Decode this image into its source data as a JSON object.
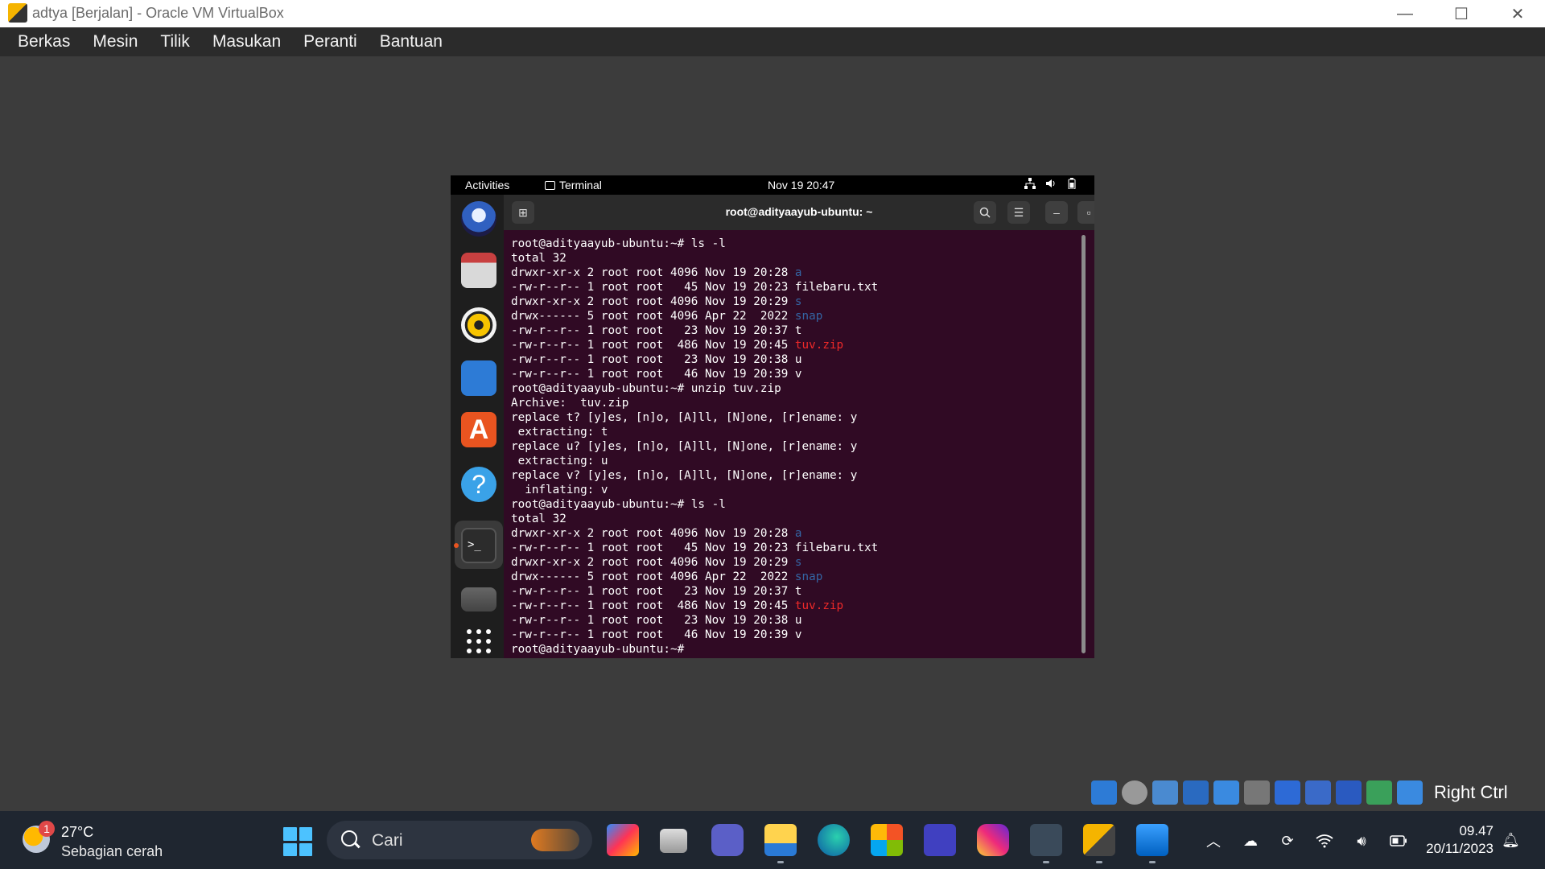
{
  "host_window": {
    "title": "adtya [Berjalan] - Oracle VM VirtualBox",
    "minimize_glyph": "—",
    "maximize_glyph": "☐",
    "close_glyph": "✕"
  },
  "menubar": [
    "Berkas",
    "Mesin",
    "Tilik",
    "Masukan",
    "Peranti",
    "Bantuan"
  ],
  "ubuntu_topbar": {
    "activities": "Activities",
    "app_name": "Terminal",
    "datetime": "Nov 19  20:47"
  },
  "terminal": {
    "title": "root@adityaayub-ubuntu: ~",
    "prompt": "root@adityaayub-ubuntu:~#",
    "lines": [
      {
        "text": "root@adityaayub-ubuntu:~# ls -l"
      },
      {
        "text": "total 32"
      },
      {
        "text": "drwxr-xr-x 2 root root 4096 Nov 19 20:28 ",
        "name": "a",
        "kind": "dir"
      },
      {
        "text": "-rw-r--r-- 1 root root   45 Nov 19 20:23 filebaru.txt"
      },
      {
        "text": "drwxr-xr-x 2 root root 4096 Nov 19 20:29 ",
        "name": "s",
        "kind": "dir"
      },
      {
        "text": "drwx------ 5 root root 4096 Apr 22  2022 ",
        "name": "snap",
        "kind": "dir"
      },
      {
        "text": "-rw-r--r-- 1 root root   23 Nov 19 20:37 t"
      },
      {
        "text": "-rw-r--r-- 1 root root  486 Nov 19 20:45 ",
        "name": "tuv.zip",
        "kind": "zip"
      },
      {
        "text": "-rw-r--r-- 1 root root   23 Nov 19 20:38 u"
      },
      {
        "text": "-rw-r--r-- 1 root root   46 Nov 19 20:39 v"
      },
      {
        "text": "root@adityaayub-ubuntu:~# unzip tuv.zip"
      },
      {
        "text": "Archive:  tuv.zip"
      },
      {
        "text": "replace t? [y]es, [n]o, [A]ll, [N]one, [r]ename: y"
      },
      {
        "text": " extracting: t"
      },
      {
        "text": "replace u? [y]es, [n]o, [A]ll, [N]one, [r]ename: y"
      },
      {
        "text": " extracting: u"
      },
      {
        "text": "replace v? [y]es, [n]o, [A]ll, [N]one, [r]ename: y"
      },
      {
        "text": "  inflating: v"
      },
      {
        "text": "root@adityaayub-ubuntu:~# ls -l"
      },
      {
        "text": "total 32"
      },
      {
        "text": "drwxr-xr-x 2 root root 4096 Nov 19 20:28 ",
        "name": "a",
        "kind": "dir"
      },
      {
        "text": "-rw-r--r-- 1 root root   45 Nov 19 20:23 filebaru.txt"
      },
      {
        "text": "drwxr-xr-x 2 root root 4096 Nov 19 20:29 ",
        "name": "s",
        "kind": "dir"
      },
      {
        "text": "drwx------ 5 root root 4096 Apr 22  2022 ",
        "name": "snap",
        "kind": "dir"
      },
      {
        "text": "-rw-r--r-- 1 root root   23 Nov 19 20:37 t"
      },
      {
        "text": "-rw-r--r-- 1 root root  486 Nov 19 20:45 ",
        "name": "tuv.zip",
        "kind": "zip"
      },
      {
        "text": "-rw-r--r-- 1 root root   23 Nov 19 20:38 u"
      },
      {
        "text": "-rw-r--r-- 1 root root   46 Nov 19 20:39 v"
      },
      {
        "text": "root@adityaayub-ubuntu:~# "
      }
    ]
  },
  "vbox_status": {
    "host_key": "Right Ctrl"
  },
  "taskbar": {
    "weather_temp": "27°C",
    "weather_condition": "Sebagian cerah",
    "weather_badge": "1",
    "search_placeholder": "Cari",
    "time": "09.47",
    "date": "20/11/2023"
  },
  "colors": {
    "terminal_bg": "#300a24",
    "dir_color": "#3465a4",
    "zip_color": "#ef2929",
    "ubuntu_accent": "#e95420"
  }
}
